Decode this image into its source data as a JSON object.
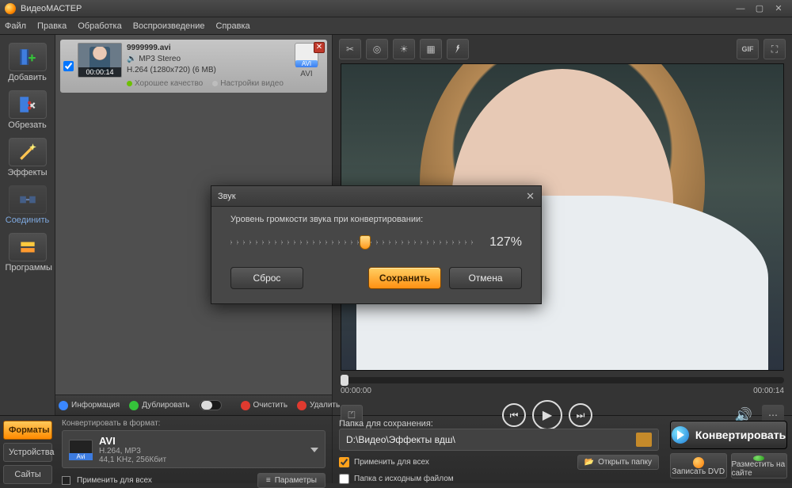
{
  "app": {
    "title": "ВидеоМАСТЕР"
  },
  "menus": [
    "Файл",
    "Правка",
    "Обработка",
    "Воспроизведение",
    "Справка"
  ],
  "sidebar": [
    {
      "label": "Добавить",
      "icon": "add"
    },
    {
      "label": "Обрезать",
      "icon": "cut"
    },
    {
      "label": "Эффекты",
      "icon": "fx"
    },
    {
      "label": "Соединить",
      "icon": "join"
    },
    {
      "label": "Программы",
      "icon": "apps"
    }
  ],
  "clip": {
    "file": "9999999.avi",
    "audio": "MP3 Stereo",
    "video_spec": "H.264 (1280x720) (6 MB)",
    "quality": "Хорошее качество",
    "settings": "Настройки видео",
    "format_label": "AVI",
    "duration": "00:00:14",
    "checked": true
  },
  "listfoot": {
    "info": "Информация",
    "dup": "Дублировать",
    "clear": "Очистить",
    "del": "Удалить"
  },
  "transport": {
    "cur": "00:00:00",
    "total": "00:00:14"
  },
  "dialog": {
    "title": "Звук",
    "label": "Уровень громкости звука при конвертировании:",
    "value": "127%",
    "percent": 55,
    "reset": "Сброс",
    "save": "Сохранить",
    "cancel": "Отмена"
  },
  "bottom": {
    "tabs": [
      "Форматы",
      "Устройства",
      "Сайты"
    ],
    "active": 0,
    "convert_to": "Конвертировать в формат:",
    "fmt_name": "AVI",
    "fmt_detail": "H.264, MP3",
    "fmt_detail2": "44,1 KHz, 256Кбит",
    "apply_all": "Применить для всех",
    "params": "Параметры",
    "path_label": "Папка для сохранения:",
    "path": "D:\\Видео\\Эффекты вдш\\",
    "apply_all2": "Применить для всех",
    "src_folder": "Папка с исходным файлом",
    "open": "Открыть папку",
    "convert": "Конвертировать",
    "dvd": "Записать DVD",
    "upload": "Разместить на сайте"
  }
}
